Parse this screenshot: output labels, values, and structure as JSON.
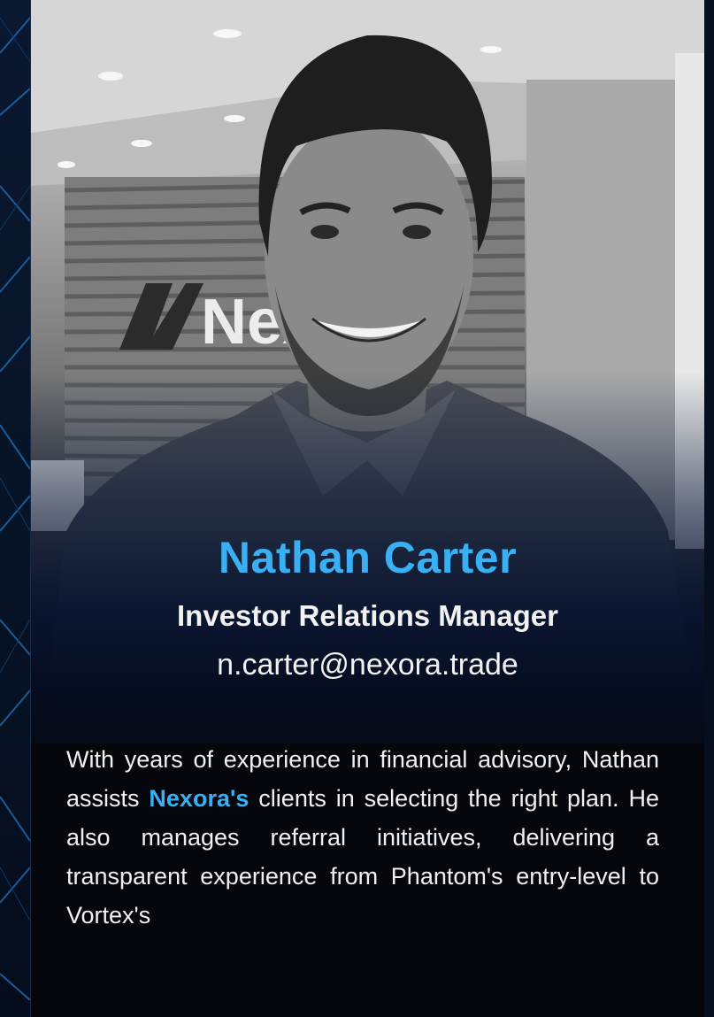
{
  "profile": {
    "name": "Nathan Carter",
    "role": "Investor Relations Manager",
    "email": "n.carter@nexora.trade",
    "photo_wall_sign": "Nex"
  },
  "bio": {
    "part1": "With years of experience in financial advisory, Nathan assists ",
    "brand": "Nexora's",
    "part2": "  clients in selecting the right plan. He also manages referral initiatives, delivering a transparent experience from Phantom's entry-level to Vortex's"
  },
  "colors": {
    "accent": "#3ab0f4",
    "background": "#05070c",
    "text": "#f1f1f1"
  }
}
